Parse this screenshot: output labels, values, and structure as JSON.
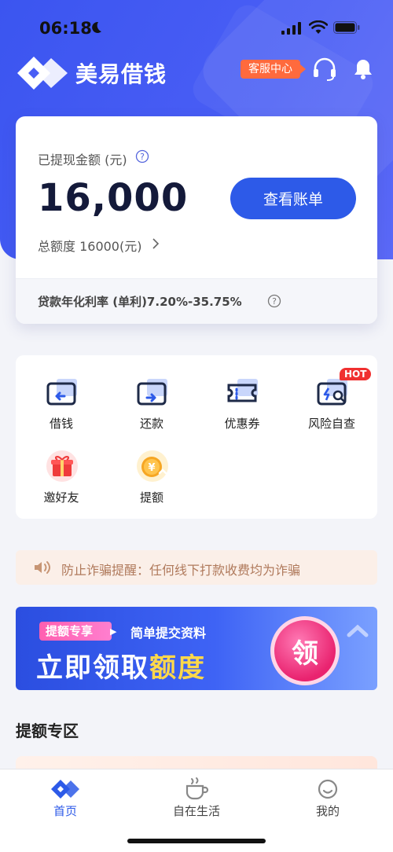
{
  "status_bar": {
    "time": "06:18"
  },
  "header": {
    "brand": "美易借钱",
    "service_label": "客服中心"
  },
  "balance_card": {
    "label": "已提现金额 (元)",
    "amount": "16,000",
    "button_label": "查看账单",
    "limit_text": "总额度 16000(元)",
    "rate_text": "贷款年化利率 (单利)7.20%-35.75%"
  },
  "quick_menu": {
    "items": [
      {
        "label": "借钱",
        "icon": "borrow-icon"
      },
      {
        "label": "还款",
        "icon": "repay-icon"
      },
      {
        "label": "优惠券",
        "icon": "coupon-icon"
      },
      {
        "label": "风险自查",
        "icon": "risk-check-icon"
      },
      {
        "label": "邀好友",
        "icon": "gift-icon"
      },
      {
        "label": "提额",
        "icon": "coin-icon"
      }
    ],
    "hot_badge": "HOT"
  },
  "notice": {
    "text": "防止诈骗提醒：任何线下打款收费均为诈骗"
  },
  "banner": {
    "tag": "提额专享",
    "subtitle": "简单提交资料",
    "main_prefix": "立即领取",
    "main_highlight": "额度",
    "circle_text": "领"
  },
  "section": {
    "title": "提额专区"
  },
  "tab_bar": {
    "tabs": [
      {
        "label": "首页",
        "active": true
      },
      {
        "label": "自在生活",
        "active": false
      },
      {
        "label": "我的",
        "active": false
      }
    ]
  },
  "colors": {
    "primary": "#2d5ae8",
    "header_bg": "#4a5ef5",
    "service_badge": "#ff6a3d",
    "hot_badge": "#f03030",
    "notice_bg": "#fbefe8"
  }
}
